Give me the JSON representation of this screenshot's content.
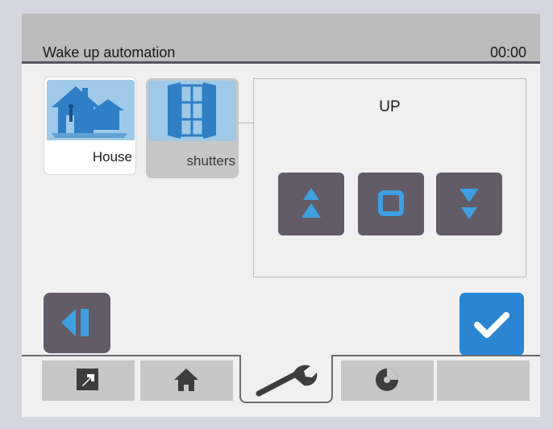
{
  "header": {
    "title": "Wake up automation",
    "clock": "00:00"
  },
  "tiles": [
    {
      "label": "House",
      "icon": "house-icon",
      "selected": true
    },
    {
      "label": "shutters",
      "icon": "shutters-icon",
      "selected": false
    }
  ],
  "panel": {
    "status": "UP",
    "controls": [
      {
        "icon": "arrow-up-icon",
        "action": "up"
      },
      {
        "icon": "stop-icon",
        "action": "stop"
      },
      {
        "icon": "arrow-down-icon",
        "action": "down"
      }
    ]
  },
  "buttons": {
    "back_icon": "back-icon",
    "confirm_icon": "checkmark-icon"
  },
  "tabs": [
    {
      "icon": "diagonal-arrow-icon",
      "active": false
    },
    {
      "icon": "home-icon",
      "active": false
    },
    {
      "icon": "wrench-icon",
      "active": true
    },
    {
      "icon": "disc-icon",
      "active": false
    },
    {
      "icon": "",
      "active": false
    }
  ],
  "colors": {
    "accent": "#2a86d3",
    "button_dark": "#615c67",
    "icon_blue": "#3f8fd1",
    "header_bg": "#bdbcbc",
    "screen_bg": "#f1f0f0"
  }
}
